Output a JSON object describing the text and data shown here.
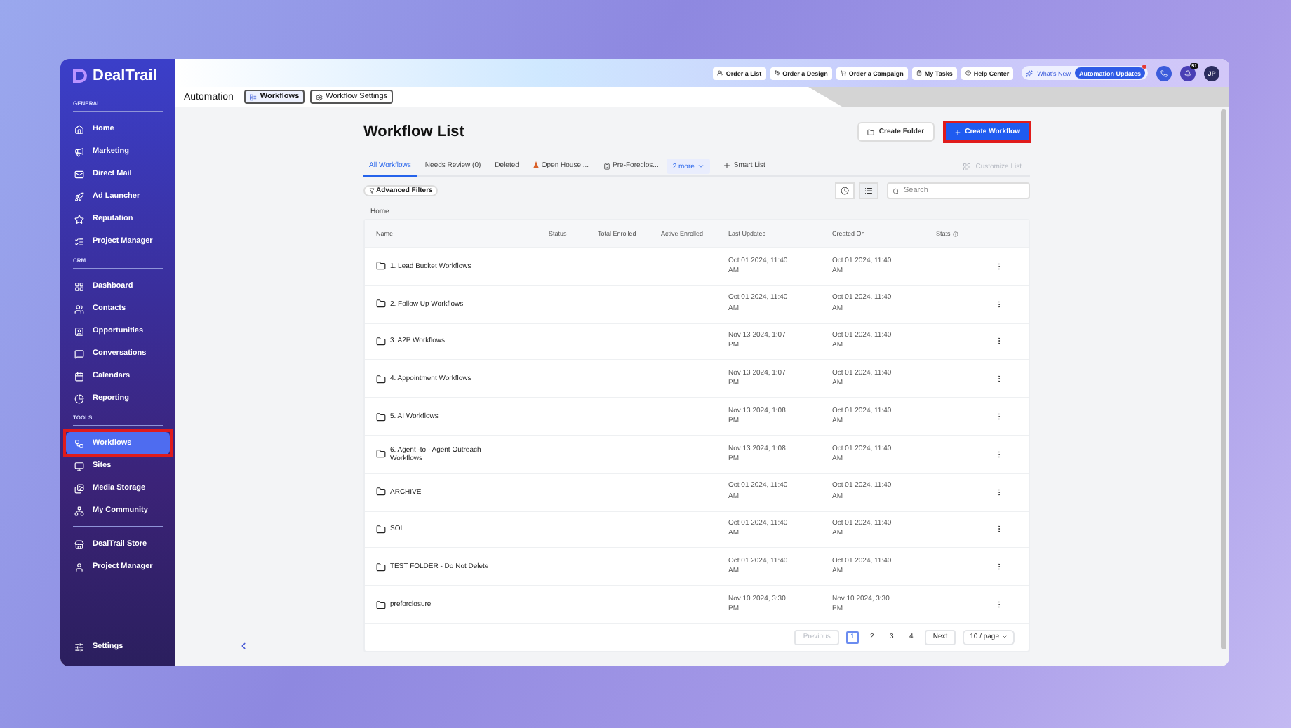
{
  "sidebar": {
    "logo": "DealTrail",
    "sections": [
      {
        "heading": "GENERAL",
        "items": [
          {
            "label": "Home",
            "selected": false,
            "highlighted": false
          },
          {
            "label": "Marketing",
            "selected": false,
            "highlighted": false
          },
          {
            "label": "Direct Mail",
            "selected": false,
            "highlighted": false
          },
          {
            "label": "Ad Launcher",
            "selected": false,
            "highlighted": false
          },
          {
            "label": "Reputation",
            "selected": false,
            "highlighted": false
          },
          {
            "label": "Project Manager",
            "selected": false,
            "highlighted": false
          }
        ]
      },
      {
        "heading": "CRM",
        "items": [
          {
            "label": "Dashboard",
            "selected": false,
            "highlighted": false
          },
          {
            "label": "Contacts",
            "selected": false,
            "highlighted": false
          },
          {
            "label": "Opportunities",
            "selected": false,
            "highlighted": false
          },
          {
            "label": "Conversations",
            "selected": false,
            "highlighted": false
          },
          {
            "label": "Calendars",
            "selected": false,
            "highlighted": false
          },
          {
            "label": "Reporting",
            "selected": false,
            "highlighted": false
          }
        ]
      },
      {
        "heading": "TOOLS",
        "items": [
          {
            "label": "Workflows",
            "selected": true,
            "highlighted": true
          },
          {
            "label": "Sites",
            "selected": false,
            "highlighted": false
          },
          {
            "label": "Media Storage",
            "selected": false,
            "highlighted": false
          },
          {
            "label": "My Community",
            "selected": false,
            "highlighted": false
          }
        ]
      },
      {
        "items": [
          {
            "label": "DealTrail Store",
            "selected": false,
            "highlighted": false
          },
          {
            "label": "Project Manager",
            "selected": false,
            "highlighted": false
          }
        ]
      }
    ],
    "settings": "Settings"
  },
  "top_bar": {
    "actions": [
      "Order a List",
      "Order a Design",
      "Order a Campaign",
      "My Tasks",
      "Help Center"
    ],
    "whats_new": "What's New",
    "updates": "Automation Updates",
    "notifications": "51",
    "avatar": "JP"
  },
  "header": {
    "title": "Automation",
    "tabs": [
      {
        "label": "Workflows",
        "selected": true
      },
      {
        "label": "Workflow Settings",
        "selected": false
      }
    ]
  },
  "page": {
    "title": "Workflow List",
    "buttons": [
      {
        "label": "Create Folder",
        "kind": "secondary",
        "highlighted": false
      },
      {
        "label": "Create Workflow",
        "kind": "primary",
        "highlighted": true
      }
    ],
    "tabs": [
      {
        "label": "All Workflows",
        "selected": true
      },
      {
        "label": "Needs Review (0)",
        "selected": false
      },
      {
        "label": "Deleted",
        "selected": false
      },
      {
        "label": "Open House ...",
        "selected": false
      },
      {
        "label": "Pre-Foreclos...",
        "selected": false
      }
    ],
    "more": "2 more",
    "smart_list": "Smart List",
    "customize": {
      "label": "Customize List",
      "disabled": true
    },
    "filters": "Advanced Filters",
    "search": {
      "placeholder": "Search"
    },
    "breadcrumb": "Home"
  },
  "table": {
    "columns": [
      "Name",
      "Status",
      "Total Enrolled",
      "Active Enrolled",
      "Last Updated",
      "Created On",
      "Stats"
    ],
    "rows": [
      {
        "name": "1. Lead Bucket Workflows",
        "last_updated": "Oct 01 2024, 11:40 AM",
        "created_on": "Oct 01 2024, 11:40 AM"
      },
      {
        "name": "2. Follow Up Workflows",
        "last_updated": "Oct 01 2024, 11:40 AM",
        "created_on": "Oct 01 2024, 11:40 AM"
      },
      {
        "name": "3. A2P Workflows",
        "last_updated": "Nov 13 2024, 1:07 PM",
        "created_on": "Oct 01 2024, 11:40 AM"
      },
      {
        "name": "4. Appointment Workflows",
        "last_updated": "Nov 13 2024, 1:07 PM",
        "created_on": "Oct 01 2024, 11:40 AM"
      },
      {
        "name": "5. AI Workflows",
        "last_updated": "Nov 13 2024, 1:08 PM",
        "created_on": "Oct 01 2024, 11:40 AM"
      },
      {
        "name": "6. Agent -to - Agent Outreach Workflows",
        "last_updated": "Nov 13 2024, 1:08 PM",
        "created_on": "Oct 01 2024, 11:40 AM"
      },
      {
        "name": "ARCHIVE",
        "last_updated": "Oct 01 2024, 11:40 AM",
        "created_on": "Oct 01 2024, 11:40 AM"
      },
      {
        "name": "SOI",
        "last_updated": "Oct 01 2024, 11:40 AM",
        "created_on": "Oct 01 2024, 11:40 AM"
      },
      {
        "name": "TEST FOLDER - Do Not Delete",
        "last_updated": "Oct 01 2024, 11:40 AM",
        "created_on": "Oct 01 2024, 11:40 AM"
      },
      {
        "name": "preforclosure",
        "last_updated": "Nov 10 2024, 3:30 PM",
        "created_on": "Nov 10 2024, 3:30 PM"
      }
    ]
  },
  "pagination": {
    "previous": {
      "label": "Previous",
      "disabled": true
    },
    "pages": [
      {
        "label": "1",
        "selected": true
      },
      {
        "label": "2",
        "selected": false
      },
      {
        "label": "3",
        "selected": false
      },
      {
        "label": "4",
        "selected": false
      }
    ],
    "next": {
      "label": "Next",
      "disabled": false
    },
    "page_size": "10 / page"
  }
}
